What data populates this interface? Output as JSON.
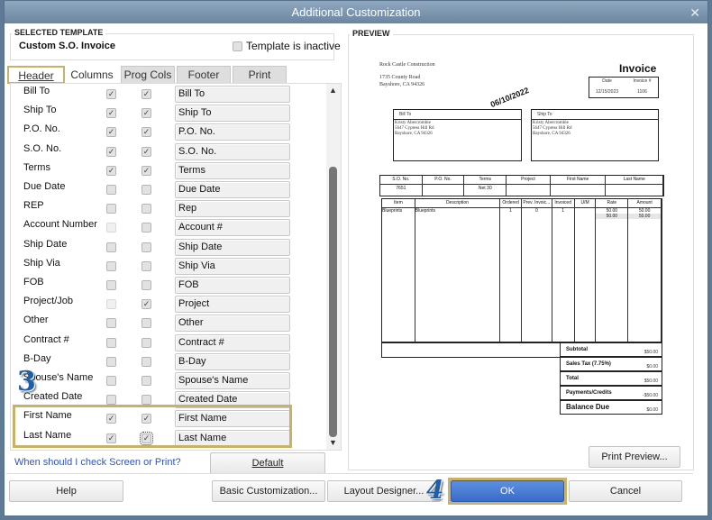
{
  "window": {
    "title": "Additional Customization"
  },
  "template": {
    "group_label": "SELECTED TEMPLATE",
    "name": "Custom S.O. Invoice",
    "inactive_label": "Template is inactive",
    "inactive": false
  },
  "tabs": [
    {
      "label": "Header",
      "active": true
    },
    {
      "label": "Columns"
    },
    {
      "label": "Prog Cols"
    },
    {
      "label": "Footer"
    },
    {
      "label": "Print"
    }
  ],
  "fields": [
    {
      "label": "Bill To",
      "screen": "checked",
      "print": "checked",
      "title": "Bill To"
    },
    {
      "label": "Ship To",
      "screen": "checked",
      "print": "checked",
      "title": "Ship To"
    },
    {
      "label": "P.O. No.",
      "screen": "checked",
      "print": "checked",
      "title": "P.O. No."
    },
    {
      "label": "S.O. No.",
      "screen": "checked",
      "print": "checked",
      "title": "S.O. No."
    },
    {
      "label": "Terms",
      "screen": "checked",
      "print": "checked",
      "title": "Terms"
    },
    {
      "label": "Due Date",
      "screen": "unchecked",
      "print": "unchecked",
      "title": "Due Date"
    },
    {
      "label": "REP",
      "screen": "unchecked",
      "print": "unchecked",
      "title": "Rep"
    },
    {
      "label": "Account Number",
      "screen": "disabled",
      "print": "unchecked",
      "title": "Account #"
    },
    {
      "label": "Ship Date",
      "screen": "unchecked",
      "print": "unchecked",
      "title": "Ship Date"
    },
    {
      "label": "Ship Via",
      "screen": "unchecked",
      "print": "unchecked",
      "title": "Ship Via"
    },
    {
      "label": "FOB",
      "screen": "unchecked",
      "print": "unchecked",
      "title": "FOB"
    },
    {
      "label": "Project/Job",
      "screen": "disabled",
      "print": "checked",
      "title": "Project"
    },
    {
      "label": "Other",
      "screen": "unchecked",
      "print": "unchecked",
      "title": "Other"
    },
    {
      "label": "Contract #",
      "screen": "unchecked",
      "print": "unchecked",
      "title": "Contract #"
    },
    {
      "label": "B-Day",
      "screen": "unchecked",
      "print": "unchecked",
      "title": "B-Day"
    },
    {
      "label": "Spouse's Name",
      "screen": "unchecked",
      "print": "unchecked",
      "title": "Spouse's Name"
    },
    {
      "label": "Created Date",
      "screen": "unchecked",
      "print": "unchecked",
      "title": "Created Date"
    },
    {
      "label": "First Name",
      "screen": "checked",
      "print": "checked",
      "title": "First Name"
    },
    {
      "label": "Last Name",
      "screen": "checked",
      "print": "checked",
      "title": "Last Name"
    }
  ],
  "help_link": "When should I check Screen or Print?",
  "buttons": {
    "default": "Default",
    "print_preview": "Print Preview...",
    "help": "Help",
    "basic": "Basic Customization...",
    "layout": "Layout Designer...",
    "ok": "OK",
    "cancel": "Cancel"
  },
  "annotations": {
    "step3": "3",
    "step4": "4"
  },
  "colors": {
    "highlight": "#c9b268",
    "ok": "#3f73cc",
    "link": "#3355bb"
  },
  "preview": {
    "label": "PREVIEW",
    "company": [
      "Rock Castle Construction",
      "1735 County Road",
      "Bayshore, CA 94326"
    ],
    "doc_title": "Invoice",
    "date_headers": [
      "Date",
      "Invoice #"
    ],
    "date_values": [
      "12/15/2023",
      "1106"
    ],
    "bill_to_label": "Bill To",
    "ship_to_label": "Ship To",
    "address": [
      "Kristy Abercrombie",
      "5647 Cypress Hill Rd",
      "Bayshore, CA 94326"
    ],
    "stamp_date": "06/10/2022",
    "header_cols": [
      "S.O. No.",
      "P.O. No.",
      "Terms",
      "Project",
      "First Name",
      "Last Name"
    ],
    "header_vals": [
      "7651",
      "",
      "Net 30",
      "",
      "",
      ""
    ],
    "item_cols": [
      "Item",
      "Description",
      "Ordered",
      "Prev. Invoic...",
      "Invoiced",
      "U/M",
      "Rate",
      "Amount"
    ],
    "item_row": [
      "Blueprints",
      "Blueprints",
      "1",
      "0",
      "1",
      "",
      "50.00",
      "50.00"
    ],
    "item_row2": [
      "",
      "",
      "",
      "",
      "",
      "",
      "50.00",
      "50.00"
    ],
    "totals": [
      {
        "label": "Subtotal",
        "value": "$50.00"
      },
      {
        "label": "Sales Tax  (7.75%)",
        "value": "$0.00"
      },
      {
        "label": "Total",
        "value": "$50.00"
      },
      {
        "label": "Payments/Credits",
        "value": "-$50.00"
      },
      {
        "label": "Balance Due",
        "value": "$0.00"
      }
    ]
  }
}
